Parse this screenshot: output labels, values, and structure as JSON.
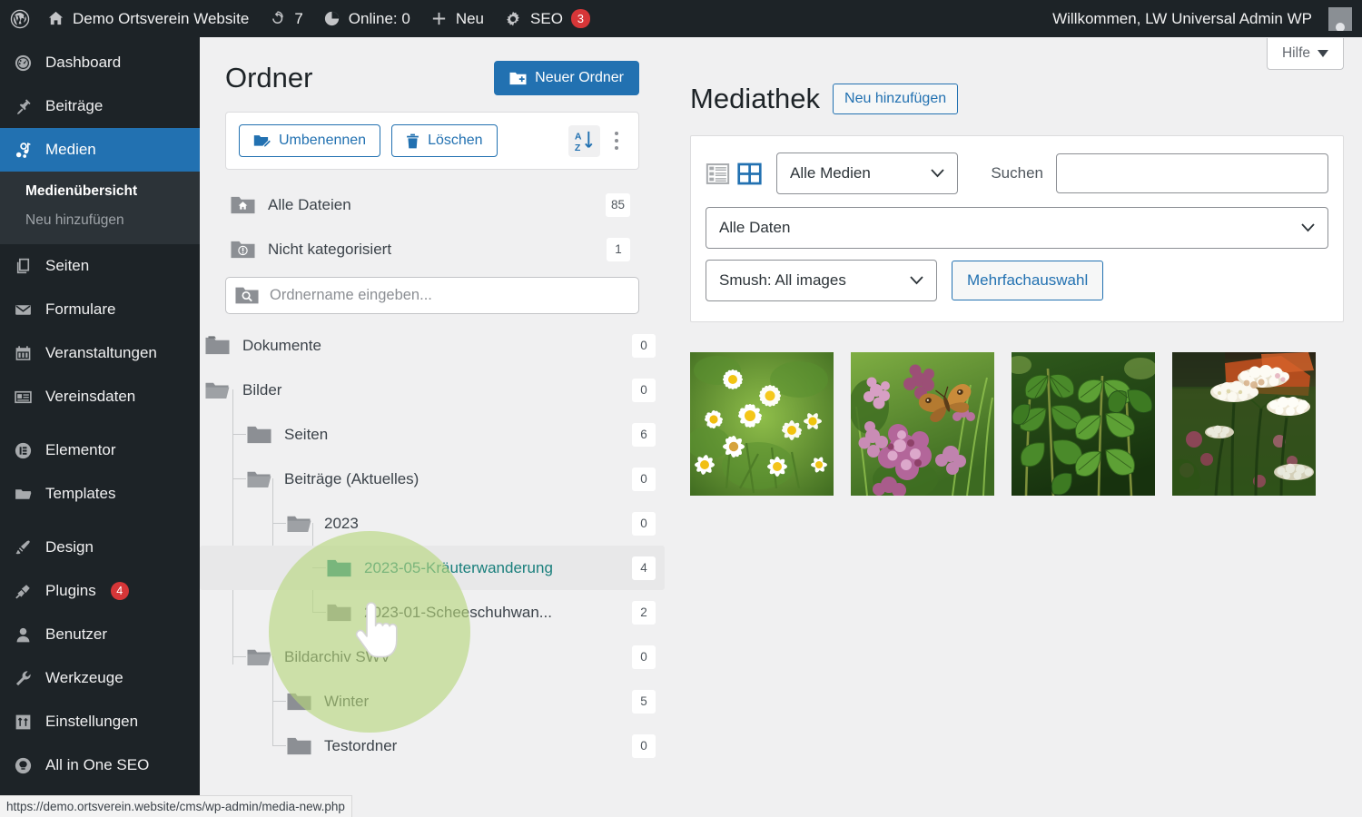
{
  "adminbar": {
    "site_name": "Demo Ortsverein Website",
    "updates_count": "7",
    "online_label": "Online: 0",
    "new_label": "Neu",
    "seo_label": "SEO",
    "seo_badge": "3",
    "greeting": "Willkommen, LW Universal Admin WP"
  },
  "sidebar": {
    "items": [
      {
        "label": "Dashboard",
        "icon": "dashboard-icon",
        "badge": ""
      },
      {
        "label": "Beiträge",
        "icon": "pin-icon",
        "badge": ""
      },
      {
        "label": "Medien",
        "icon": "media-icon",
        "badge": "",
        "current": true
      },
      {
        "label": "Seiten",
        "icon": "pages-icon",
        "badge": ""
      },
      {
        "label": "Formulare",
        "icon": "envelope-icon",
        "badge": ""
      },
      {
        "label": "Veranstaltungen",
        "icon": "calendar-icon",
        "badge": ""
      },
      {
        "label": "Vereinsdaten",
        "icon": "id-card-icon",
        "badge": ""
      },
      {
        "label": "Elementor",
        "icon": "elementor-icon",
        "badge": ""
      },
      {
        "label": "Templates",
        "icon": "folder-icon",
        "badge": ""
      },
      {
        "label": "Design",
        "icon": "brush-icon",
        "badge": ""
      },
      {
        "label": "Plugins",
        "icon": "plug-icon",
        "badge": "4"
      },
      {
        "label": "Benutzer",
        "icon": "user-icon",
        "badge": ""
      },
      {
        "label": "Werkzeuge",
        "icon": "wrench-icon",
        "badge": ""
      },
      {
        "label": "Einstellungen",
        "icon": "sliders-icon",
        "badge": ""
      },
      {
        "label": "All in One SEO",
        "icon": "aioseo-icon",
        "badge": ""
      }
    ],
    "submenu": [
      {
        "label": "Medienübersicht",
        "current": true
      },
      {
        "label": "Neu hinzufügen",
        "current": false
      }
    ]
  },
  "folders": {
    "title": "Ordner",
    "new_folder_button": "Neuer Ordner",
    "rename_button": "Umbenennen",
    "delete_button": "Löschen",
    "sort_icon": "sort-az-icon",
    "more_icon": "kebab-menu-icon",
    "search_placeholder": "Ordnername eingeben...",
    "search_value": "",
    "top": [
      {
        "label": "Alle Dateien",
        "count": "85",
        "icon": "home-folder-icon"
      },
      {
        "label": "Nicht kategorisiert",
        "count": "1",
        "icon": "uncategorized-folder-icon"
      }
    ],
    "tree": [
      {
        "label": "Dokumente",
        "count": "0",
        "depth": 0,
        "state": "closed"
      },
      {
        "label": "Bilder",
        "count": "0",
        "depth": 0,
        "state": "open"
      },
      {
        "label": "Seiten",
        "count": "6",
        "depth": 1,
        "state": "closed"
      },
      {
        "label": "Beiträge (Aktuelles)",
        "count": "0",
        "depth": 1,
        "state": "open"
      },
      {
        "label": "2023",
        "count": "0",
        "depth": 2,
        "state": "open"
      },
      {
        "label": "2023-05-Kräuterwanderung",
        "count": "4",
        "depth": 3,
        "state": "closed",
        "selected": true
      },
      {
        "label": "2023-01-Scheeschuhwan...",
        "count": "2",
        "depth": 3,
        "state": "closed"
      },
      {
        "label": "Bildarchiv SWV",
        "count": "0",
        "depth": 1,
        "state": "open"
      },
      {
        "label": "Winter",
        "count": "5",
        "depth": 2,
        "state": "closed"
      },
      {
        "label": "Testordner",
        "count": "0",
        "depth": 2,
        "state": "closed"
      }
    ]
  },
  "media": {
    "help_button": "Hilfe",
    "title": "Mediathek",
    "add_new_button": "Neu hinzufügen",
    "view_list_icon": "list-view-icon",
    "view_grid_icon": "grid-view-icon",
    "filter_type": "Alle Medien",
    "filter_date": "Alle Daten",
    "filter_smush": "Smush: All images",
    "bulk_select_button": "Mehrfachauswahl",
    "search_label": "Suchen",
    "search_value": "",
    "search_placeholder": "",
    "thumbnails": [
      {
        "alt": "Kamillenblüten auf Wiese",
        "name": "chamomile-thumbnail"
      },
      {
        "alt": "Schmetterling auf Oregano-Blüten",
        "name": "butterfly-oregano-thumbnail"
      },
      {
        "alt": "Brennnesselblätter",
        "name": "nettle-thumbnail"
      },
      {
        "alt": "Schafgarbe vor rotem Dach",
        "name": "yarrow-thumbnail"
      }
    ]
  },
  "statusbar": {
    "url": "https://demo.ortsverein.website/cms/wp-admin/media-new.php"
  },
  "colors": {
    "accent": "#2271b1",
    "admin_bg": "#1d2327",
    "badge_red": "#d63638",
    "selected_folder_teal": "#1a7f7c",
    "spotlight_green": "#b7d67a"
  }
}
